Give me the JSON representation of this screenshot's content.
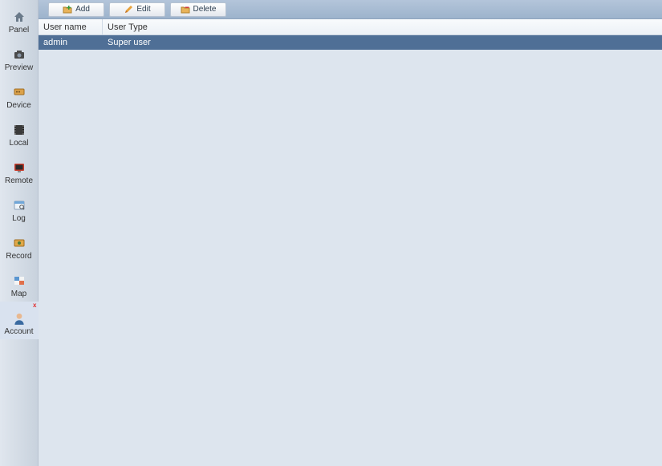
{
  "sidebar": {
    "items": [
      {
        "label": "Panel",
        "icon": "home-icon"
      },
      {
        "label": "Preview",
        "icon": "camera-icon"
      },
      {
        "label": "Device",
        "icon": "device-icon"
      },
      {
        "label": "Local",
        "icon": "film-icon"
      },
      {
        "label": "Remote",
        "icon": "monitor-icon"
      },
      {
        "label": "Log",
        "icon": "log-icon"
      },
      {
        "label": "Record",
        "icon": "record-icon"
      },
      {
        "label": "Map",
        "icon": "map-icon"
      },
      {
        "label": "Account",
        "icon": "person-icon",
        "active": true,
        "closable": true
      }
    ]
  },
  "toolbar": {
    "add_label": "Add",
    "edit_label": "Edit",
    "delete_label": "Delete"
  },
  "table": {
    "columns": {
      "user_name": "User name",
      "user_type": "User Type"
    },
    "rows": [
      {
        "user_name": "admin",
        "user_type": "Super user",
        "selected": true
      }
    ]
  }
}
